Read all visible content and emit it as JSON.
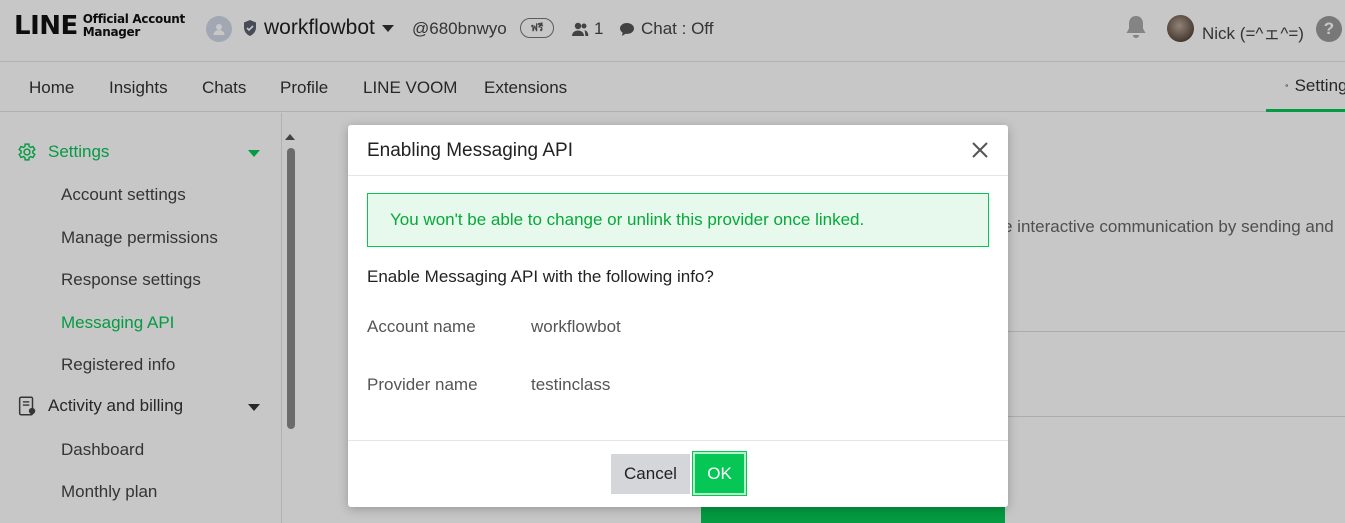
{
  "header": {
    "logo_main": "LINE",
    "logo_sub_line1": "Official Account",
    "logo_sub_line2": "Manager",
    "account_name": "workflowbot",
    "account_id": "@680bnwyo",
    "plan_badge": "ฟรี",
    "friends_count": "1",
    "chat_status": "Chat : Off",
    "user_name": "Nick (=^ェ^=)",
    "help_label": "?",
    "icons": [
      "account-avatar-icon",
      "shield-icon",
      "people-icon",
      "chat-bubble-icon",
      "bell-icon",
      "user-avatar",
      "help-icon"
    ]
  },
  "nav": {
    "items": [
      "Home",
      "Insights",
      "Chats",
      "Profile",
      "LINE VOOM",
      "Extensions"
    ],
    "settings_label": "Settings"
  },
  "sidebar": {
    "settings_group": "Settings",
    "settings_items": [
      "Account settings",
      "Manage permissions",
      "Response settings",
      "Messaging API",
      "Registered info"
    ],
    "active_item": "Messaging API",
    "billing_group": "Activity and billing",
    "billing_items": [
      "Dashboard",
      "Monthly plan"
    ]
  },
  "main": {
    "background_text": "e interactive communication by sending and"
  },
  "modal": {
    "title": "Enabling Messaging API",
    "notice": "You won't be able to change or unlink this provider once linked.",
    "question": "Enable Messaging API with the following info?",
    "account_name_label": "Account name",
    "account_name_value": "workflowbot",
    "provider_name_label": "Provider name",
    "provider_name_value": "testinclass",
    "cancel_label": "Cancel",
    "ok_label": "OK"
  },
  "colors": {
    "brand_green": "#06c755",
    "notice_bg": "#e6f9ec",
    "cancel_bg": "#d4d6da"
  }
}
